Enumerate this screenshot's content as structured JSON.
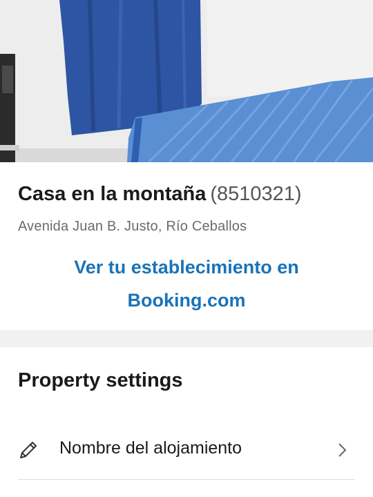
{
  "property": {
    "name": "Casa en la montaña",
    "id": "(8510321)",
    "address": "Avenida Juan B. Justo, Río Ceballos",
    "link_line1": "Ver tu establecimiento en",
    "link_line2": "Booking.com"
  },
  "settings": {
    "title": "Property settings",
    "items": [
      {
        "icon": "pencil-icon",
        "label": "Nombre del alojamiento"
      }
    ]
  },
  "colors": {
    "link": "#1a73b8",
    "separator": "#f1f1f1",
    "curtain": "#2e55a3",
    "bedspread": "#5a8fd4"
  }
}
